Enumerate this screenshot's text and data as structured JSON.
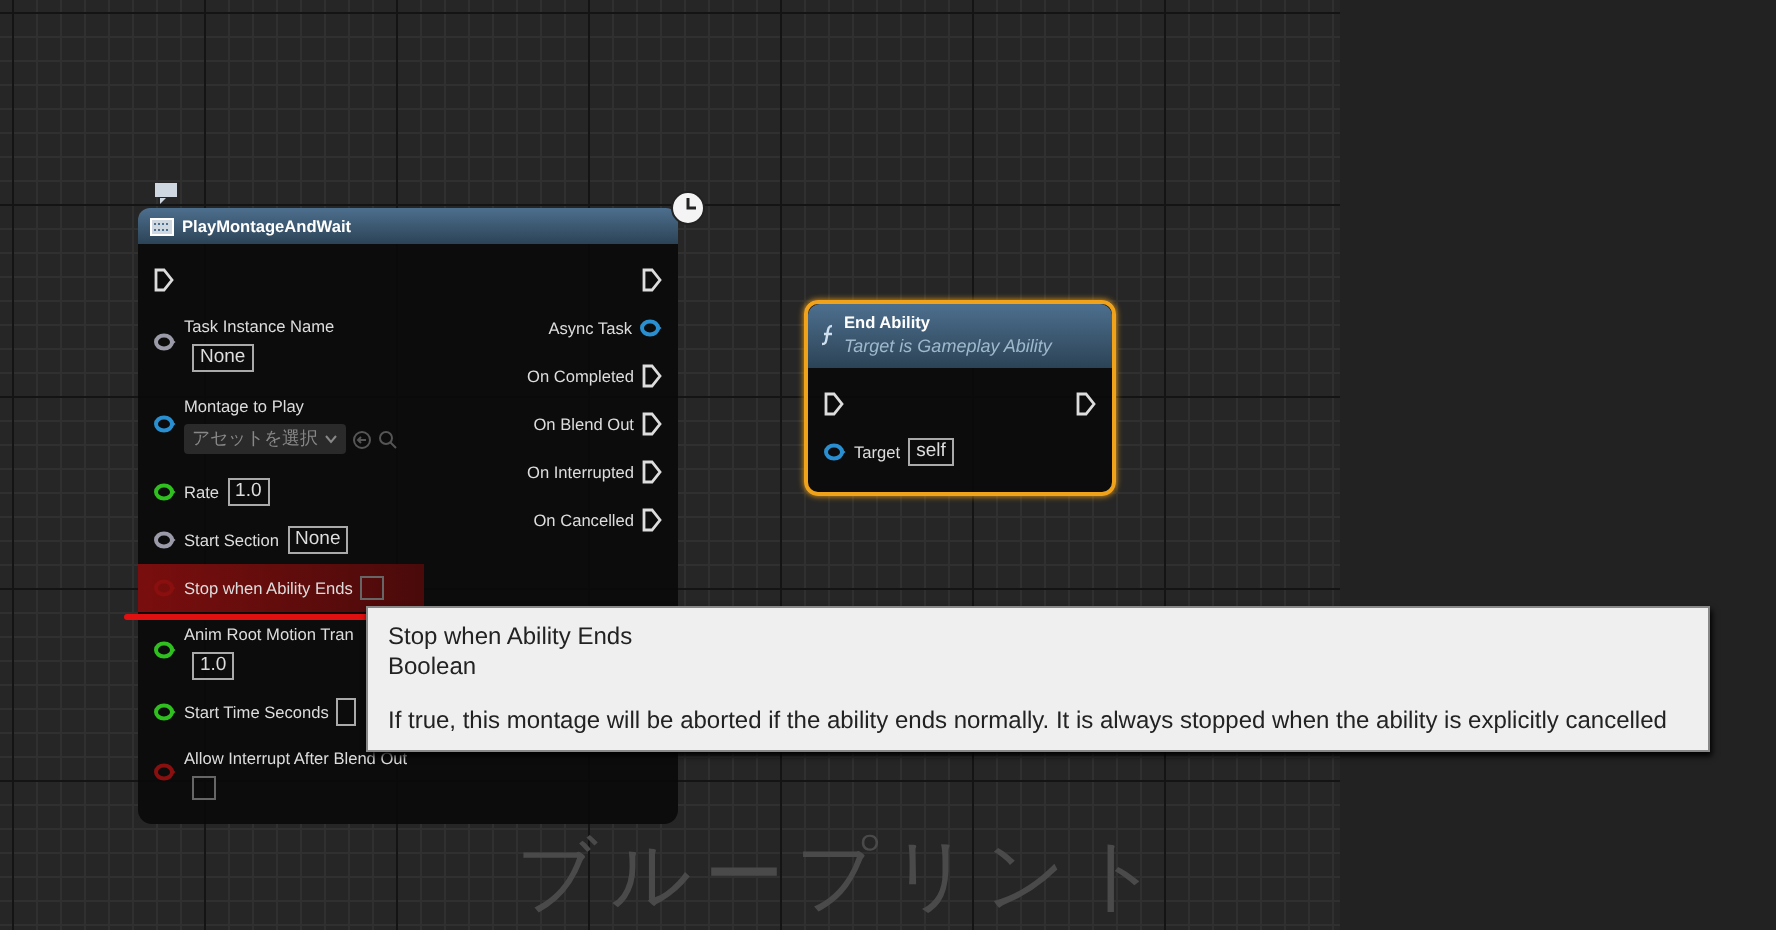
{
  "graph_label": "ブループリント",
  "nodes": [
    {
      "kind": "latent",
      "title": "PlayMontageAndWait",
      "selected": false,
      "inputs": [
        {
          "kind": "exec"
        },
        {
          "kind": "text",
          "label": "Task Instance Name",
          "value": "None",
          "color": "#9a9aa8"
        },
        {
          "kind": "asset",
          "label": "Montage to Play",
          "value": "アセットを選択",
          "color": "#2a8fd0"
        },
        {
          "kind": "inline",
          "label": "Rate",
          "value": "1.0",
          "color": "#2fbf1f"
        },
        {
          "kind": "inline",
          "label": "Start Section",
          "value": "None",
          "color": "#9a9aa8"
        },
        {
          "kind": "bool",
          "label": "Stop when Ability Ends",
          "checked": false,
          "hovered": true,
          "color": "#8a0f0f"
        },
        {
          "kind": "text",
          "label": "Anim Root Motion Tran",
          "value": "1.0",
          "color": "#2fbf1f"
        },
        {
          "kind": "inline",
          "label": "Start Time Seconds",
          "color": "#2fbf1f"
        },
        {
          "kind": "bool",
          "label": "Allow Interrupt After Blend Out",
          "checked": false,
          "hovered": false,
          "color": "#8a0f0f"
        }
      ],
      "outputs": [
        {
          "kind": "exec"
        },
        {
          "kind": "data",
          "label": "Async Task",
          "color": "#2a8fd0"
        },
        {
          "kind": "exec",
          "label": "On Completed"
        },
        {
          "kind": "exec",
          "label": "On Blend Out"
        },
        {
          "kind": "exec",
          "label": "On Interrupted"
        },
        {
          "kind": "exec",
          "label": "On Cancelled"
        }
      ]
    },
    {
      "kind": "function",
      "title": "End Ability",
      "subtitle": "Target is Gameplay Ability",
      "selected": true,
      "inputs": [
        {
          "kind": "exec"
        },
        {
          "kind": "inline",
          "label": "Target",
          "value": "self",
          "color": "#2a8fd0"
        }
      ],
      "outputs": [
        {
          "kind": "exec"
        }
      ]
    }
  ],
  "tooltip": {
    "title": "Stop when Ability Ends",
    "type": "Boolean",
    "description": "If true, this montage will be aborted if the ability ends normally. It is always stopped when the ability is explicitly cancelled"
  }
}
